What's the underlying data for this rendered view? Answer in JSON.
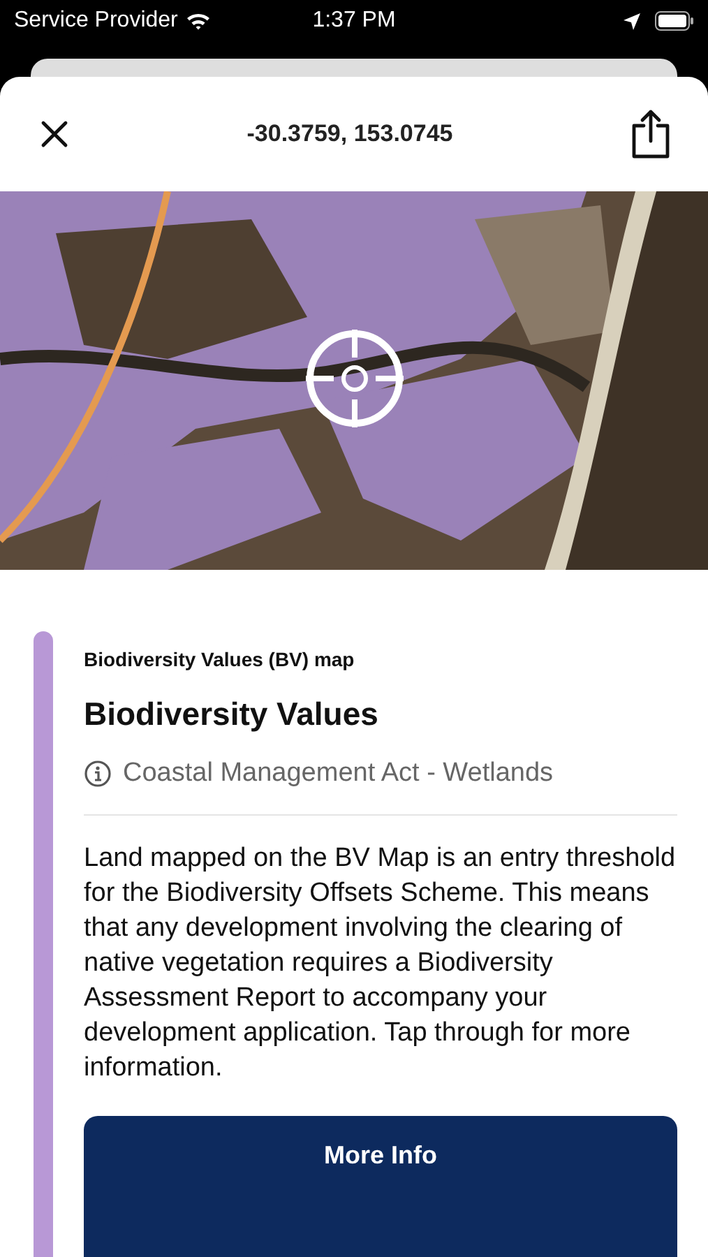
{
  "status_bar": {
    "carrier": "Service Provider",
    "time": "1:37 PM"
  },
  "header": {
    "title": "-30.3759, 153.0745"
  },
  "card": {
    "overline": "Biodiversity Values (BV) map",
    "title": "Biodiversity Values",
    "subtitle": "Coastal Management Act - Wetlands",
    "body": "Land mapped on the BV Map is an entry threshold for the Biodiversity Offsets Scheme. This means that any development involving the clearing of native vegetation requires a Biodiversity Assessment Report to accompany your development application. Tap through for more information.",
    "button": "More Info"
  }
}
